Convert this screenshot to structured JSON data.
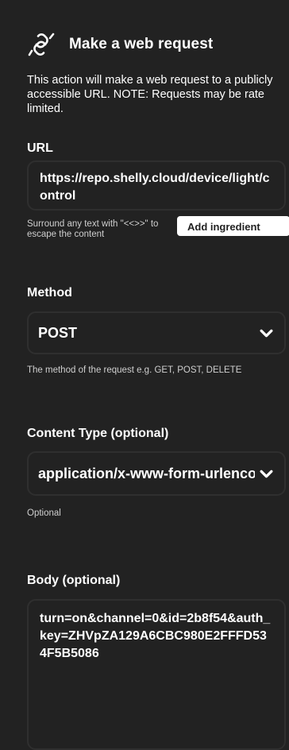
{
  "header": {
    "title": "Make a web request",
    "icon": "link-icon"
  },
  "description": "This action will make a web request to a publicly accessible URL. NOTE: Requests may be rate limited.",
  "url": {
    "label": "URL",
    "value": "https://repo.shelly.cloud/device/light/control",
    "help": "Surround any text with \"<<>>\" to escape the content",
    "add_ingredient_label": "Add ingredient"
  },
  "method": {
    "label": "Method",
    "value": "POST",
    "help": "The method of the request e.g. GET, POST, DELETE"
  },
  "content_type": {
    "label": "Content Type (optional)",
    "value": "application/x-www-form-urlencoded",
    "help": "Optional"
  },
  "body": {
    "label": "Body (optional)",
    "value": "turn=on&channel=0&id=2b8f54&auth_key=ZHVpZA129A6CBC980E2FFFD534F5B5086"
  },
  "colors": {
    "background": "#222222",
    "field_border": "#2f2f2f",
    "text": "#ffffff",
    "help_text": "#cfcfcf"
  }
}
